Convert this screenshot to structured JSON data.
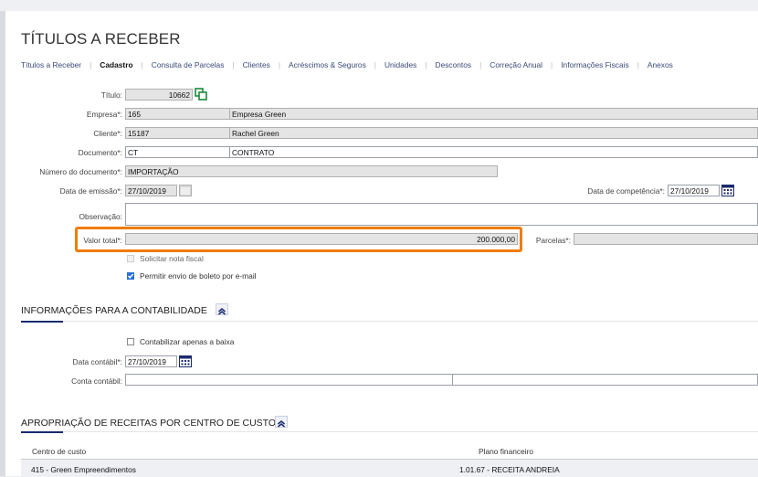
{
  "header": {
    "title": "TÍTULOS A RECEBER"
  },
  "tabs": [
    {
      "label": "Títulos a Receber"
    },
    {
      "label": "Cadastro"
    },
    {
      "label": "Consulta de Parcelas"
    },
    {
      "label": "Clientes"
    },
    {
      "label": "Acréscimos & Seguros"
    },
    {
      "label": "Unidades"
    },
    {
      "label": "Descontos"
    },
    {
      "label": "Correção Anual"
    },
    {
      "label": "Informações Fiscais"
    },
    {
      "label": "Anexos"
    }
  ],
  "form": {
    "titulo_label": "Título:",
    "titulo_value": "10662",
    "empresa_label": "Empresa*:",
    "empresa_code": "165",
    "empresa_name": "Empresa Green",
    "cliente_label": "Cliente*:",
    "cliente_code": "15187",
    "cliente_name": "Rachel Green",
    "documento_label": "Documento*:",
    "documento_code": "CT",
    "documento_name": "CONTRATO",
    "numdoc_label": "Número do documento*:",
    "numdoc_value": "IMPORTAÇÃO",
    "emissao_label": "Data de emissão*:",
    "emissao_value": "27/10/2019",
    "competencia_label": "Data de competência*:",
    "competencia_value": "27/10/2019",
    "observacao_label": "Observação:",
    "observacao_value": "",
    "valor_label": "Valor total*:",
    "valor_value": "200.000,00",
    "parcelas_label": "Parcelas*:",
    "parcelas_value": "",
    "nota_fiscal_label": "Solicitar nota fiscal",
    "nota_fiscal_checked": false,
    "boleto_label": "Permitir envio de boleto por e-mail",
    "boleto_checked": true
  },
  "contabilidade": {
    "title": "INFORMAÇÕES PARA A CONTABILIDADE",
    "contabilizar_label": "Contabilizar apenas a baixa",
    "contabilizar_checked": false,
    "data_label": "Data contábil*:",
    "data_value": "27/10/2019",
    "conta_label": "Conta contábil:",
    "conta_value": ""
  },
  "apropriacao": {
    "title": "APROPRIAÇÃO DE RECEITAS POR CENTRO DE CUSTO",
    "columns": [
      "Centro de custo",
      "Plano financeiro"
    ],
    "rows": [
      {
        "centro": "415 - Green Empreendimentos",
        "plano": "1.01.67 - RECEITA ANDREIA"
      }
    ]
  },
  "colors": {
    "accent": "#1a2a6e",
    "highlight": "#f07c00",
    "link": "#3a4a78"
  },
  "icons": [
    "copy-icon",
    "calendar-icon",
    "chevron-up-icon",
    "check-icon"
  ]
}
